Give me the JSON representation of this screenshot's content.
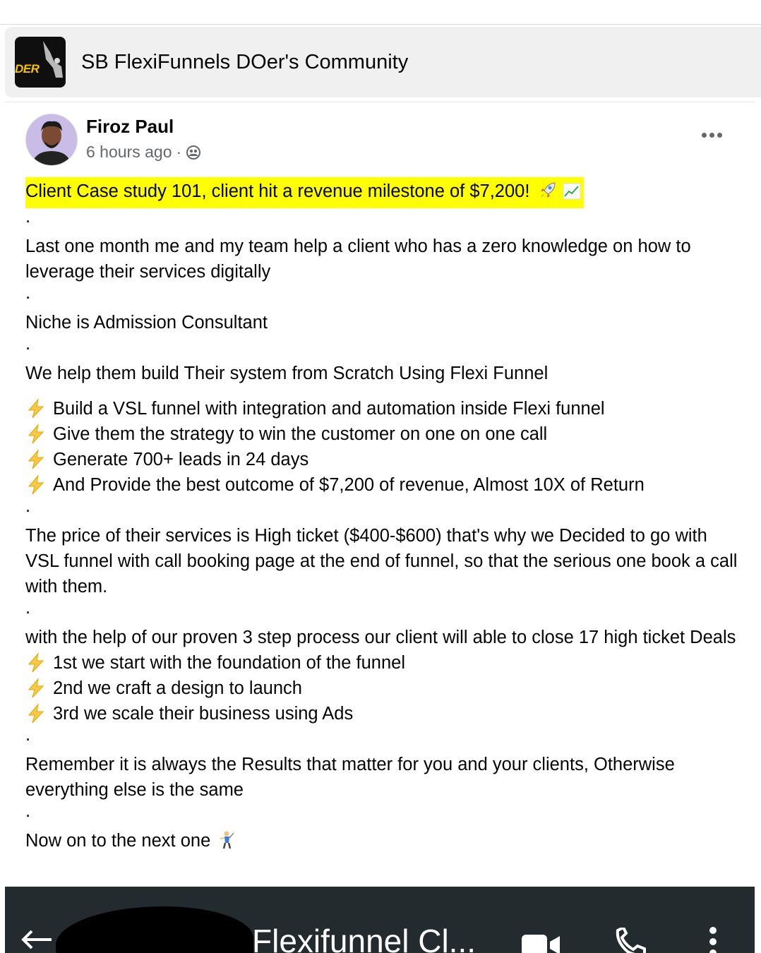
{
  "group": {
    "name": "SB FlexiFunnels DOer's Community",
    "logo_text": "DER"
  },
  "post": {
    "author": "Firoz Paul",
    "time": "6 hours ago",
    "separator": "·",
    "audience_icon": "group-icon",
    "more_icon": "more-options-icon",
    "headline": "Client Case study 101, client hit a revenue milestone of $7,200!",
    "headline_emojis": [
      "rocket-icon",
      "chart-increasing-icon"
    ],
    "dot": ".",
    "para1": "Last one month me and my team help a client who has a zero knowledge on how to leverage their services digitally",
    "para2": "Niche is Admission Consultant",
    "para3": "We help them build Their system from Scratch Using Flexi Funnel",
    "bullets1": [
      "Build a VSL funnel with integration and automation inside Flexi funnel",
      "Give them the strategy to win the customer on one on one call",
      "Generate 700+ leads in 24 days",
      "And Provide the best outcome of $7,200 of revenue, Almost 10X of Return"
    ],
    "para4": "The price of their services is High ticket ($400-$600) that's why we Decided to go with VSL funnel with call booking page at the end of funnel, so that the serious one book a call with them.",
    "para5": "with the help of our proven 3 step process our client will able to close 17 high ticket Deals",
    "bullets2": [
      "1st we start with the foundation of the funnel",
      "2nd we craft a design to launch",
      "3rd we scale their business using Ads"
    ],
    "para6": "Remember it is always the Results that matter for you and your clients, Otherwise everything else is the same",
    "para7": "Now on to the next one",
    "para7_emoji": "person-golfing-icon",
    "bullet_icon": "high-voltage-icon"
  },
  "attachment": {
    "title": "Flexifunnel Cl...",
    "icons": [
      "back-arrow-icon",
      "video-camera-icon",
      "phone-icon",
      "kebab-menu-icon"
    ]
  },
  "colors": {
    "highlight": "#ffff00",
    "header_bg": "#f0f0f0",
    "meta_text": "#65676b",
    "footer_bg": "#232b2f"
  }
}
